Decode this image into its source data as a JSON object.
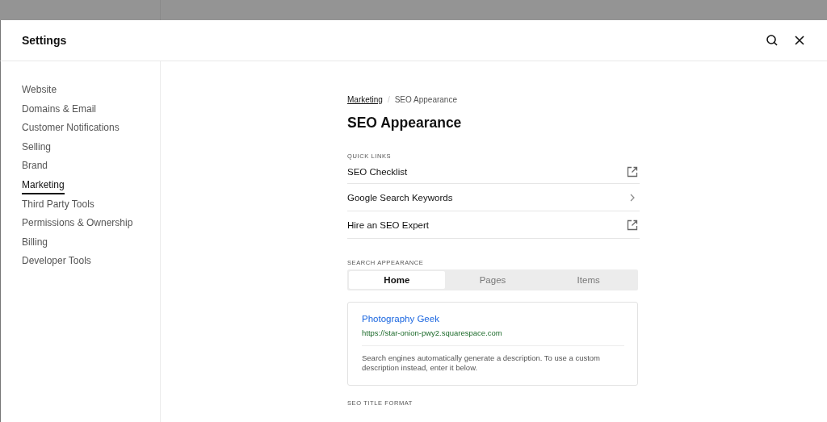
{
  "window": {
    "title": "Settings"
  },
  "sidebar": {
    "items": [
      {
        "label": "Website",
        "selected": false
      },
      {
        "label": "Domains & Email",
        "selected": false
      },
      {
        "label": "Customer Notifications",
        "selected": false
      },
      {
        "label": "Selling",
        "selected": false
      },
      {
        "label": "Brand",
        "selected": false
      },
      {
        "label": "Marketing",
        "selected": true
      },
      {
        "label": "Third Party Tools",
        "selected": false
      },
      {
        "label": "Permissions & Ownership",
        "selected": false
      },
      {
        "label": "Billing",
        "selected": false
      },
      {
        "label": "Developer Tools",
        "selected": false
      }
    ]
  },
  "breadcrumb": {
    "parent": "Marketing",
    "separator": "/",
    "current": "SEO Appearance"
  },
  "page_title": "SEO Appearance",
  "quick_links": {
    "heading": "QUICK LINKS",
    "items": [
      {
        "label": "SEO Checklist",
        "kind": "external"
      },
      {
        "label": "Google Search Keywords",
        "kind": "chevron"
      },
      {
        "label": "Hire an SEO Expert",
        "kind": "external"
      }
    ]
  },
  "search_appearance": {
    "heading": "SEARCH APPEARANCE",
    "tabs": [
      {
        "label": "Home",
        "selected": true
      },
      {
        "label": "Pages",
        "selected": false
      },
      {
        "label": "Items",
        "selected": false
      }
    ],
    "preview": {
      "title": "Photography Geek",
      "url": "https://star-onion-pwy2.squarespace.com",
      "description": "Search engines automatically generate a description. To use a custom description instead, enter it below."
    }
  },
  "seo_title_format": {
    "heading": "SEO TITLE FORMAT"
  }
}
